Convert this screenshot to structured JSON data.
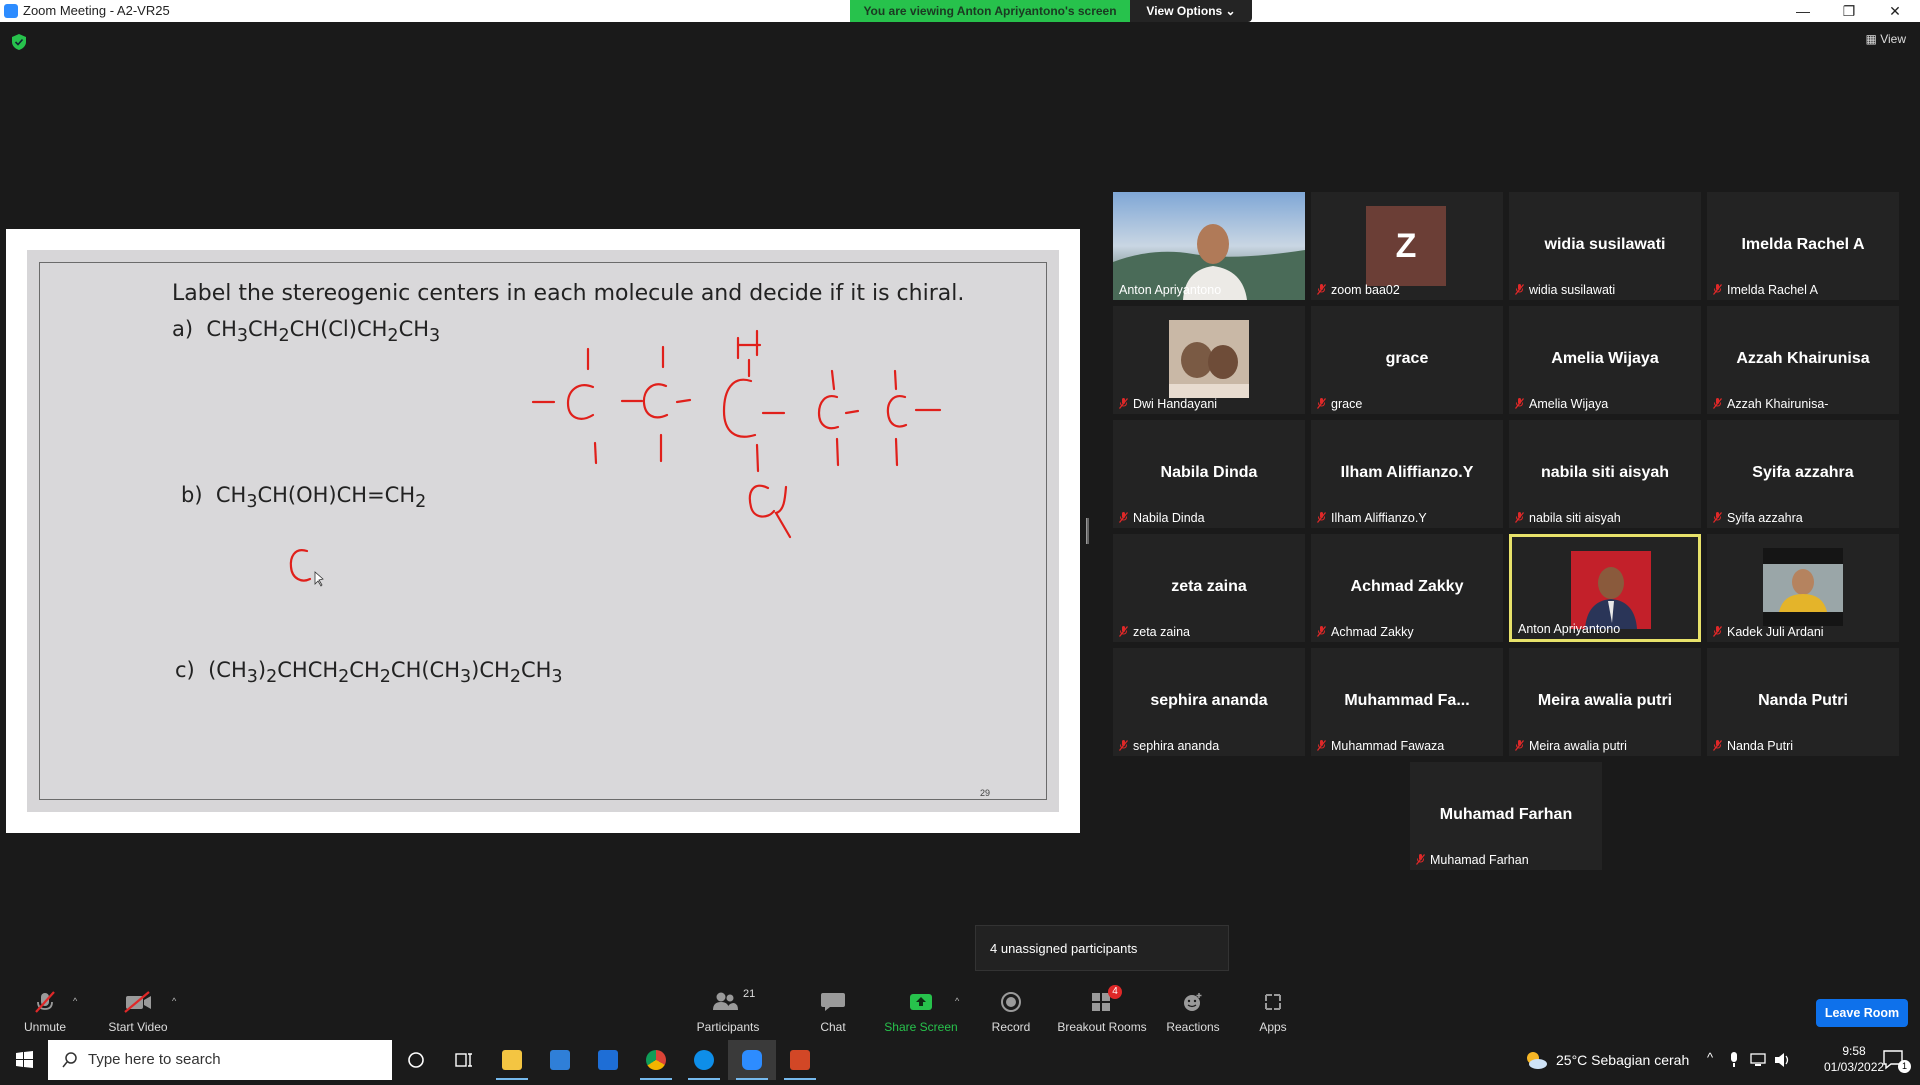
{
  "window": {
    "title": "Zoom Meeting - A2-VR25",
    "minimize": "—",
    "maximize": "❐",
    "close": "✕"
  },
  "banner": {
    "viewing": "You are viewing Anton Apriyantono's screen",
    "view_options": "View Options ⌄"
  },
  "top_right": {
    "view_label": "View"
  },
  "slide": {
    "title": "Label the stereogenic centers in each molecule and decide if it is chiral.",
    "page_number": "29"
  },
  "gallery": [
    {
      "tile_name": "Anton Apriyantono",
      "label": "Anton Apriyantono",
      "video": true,
      "muted": false
    },
    {
      "tile_name": "zoom baa02",
      "label": "zoom baa02",
      "avatar": "Z",
      "muted": true
    },
    {
      "tile_name": "widia susilawati",
      "label": "widia susilawati",
      "muted": true
    },
    {
      "tile_name": "Imelda Rachel A",
      "label": "Imelda Rachel A",
      "muted": true
    },
    {
      "tile_name": "Dwi Handayani",
      "label": "Dwi Handayani",
      "photo": true,
      "muted": true
    },
    {
      "tile_name": "grace",
      "label": "grace",
      "muted": true
    },
    {
      "tile_name": "Amelia Wijaya",
      "label": "Amelia Wijaya",
      "muted": true
    },
    {
      "tile_name": "Azzah Khairunisa",
      "label": "Azzah Khairunisa-",
      "muted": true
    },
    {
      "tile_name": "Nabila Dinda",
      "label": "Nabila Dinda",
      "muted": true
    },
    {
      "tile_name": "Ilham Aliffianzo.Y",
      "label": "Ilham Aliffianzo.Y",
      "muted": true
    },
    {
      "tile_name": "nabila siti aisyah",
      "label": "nabila siti aisyah",
      "muted": true
    },
    {
      "tile_name": "Syifa azzahra",
      "label": "Syifa azzahra",
      "muted": true
    },
    {
      "tile_name": "zeta zaina",
      "label": "zeta zaina",
      "muted": true
    },
    {
      "tile_name": "Achmad Zakky",
      "label": "Achmad Zakky",
      "muted": true
    },
    {
      "tile_name": "Anton Apriyantono",
      "label": "Anton Apriyantono",
      "photo": true,
      "active": true,
      "muted": false
    },
    {
      "tile_name": "Kadek Juli Ardani",
      "label": "Kadek Juli Ardani",
      "photo": true,
      "muted": true
    },
    {
      "tile_name": "sephira ananda",
      "label": "sephira ananda",
      "muted": true
    },
    {
      "tile_name": "Muhammad  Fa...",
      "label": "Muhammad Fawaza",
      "muted": true
    },
    {
      "tile_name": "Meira awalia putri",
      "label": "Meira awalia putri",
      "muted": true
    },
    {
      "tile_name": "Nanda Putri",
      "label": "Nanda Putri",
      "muted": true
    },
    {
      "tile_name": "Muhamad Farhan",
      "label": "Muhamad Farhan",
      "muted": true
    }
  ],
  "unassigned": "4 unassigned participants",
  "toolbar": {
    "unmute": "Unmute",
    "start_video": "Start Video",
    "participants": "Participants",
    "participants_count": "21",
    "chat": "Chat",
    "share_screen": "Share Screen",
    "record": "Record",
    "breakout_rooms": "Breakout Rooms",
    "breakout_badge": "4",
    "reactions": "Reactions",
    "apps": "Apps",
    "leave_room": "Leave Room"
  },
  "taskbar": {
    "search_placeholder": "Type here to search",
    "weather": "25°C  Sebagian cerah",
    "time": "9:58",
    "date": "01/03/2022",
    "notifications": "1"
  },
  "colors": {
    "banner_green": "#27c24c",
    "leave_blue": "#0e71eb",
    "active_border": "#e8e26a",
    "ink_red": "#e0201b"
  }
}
